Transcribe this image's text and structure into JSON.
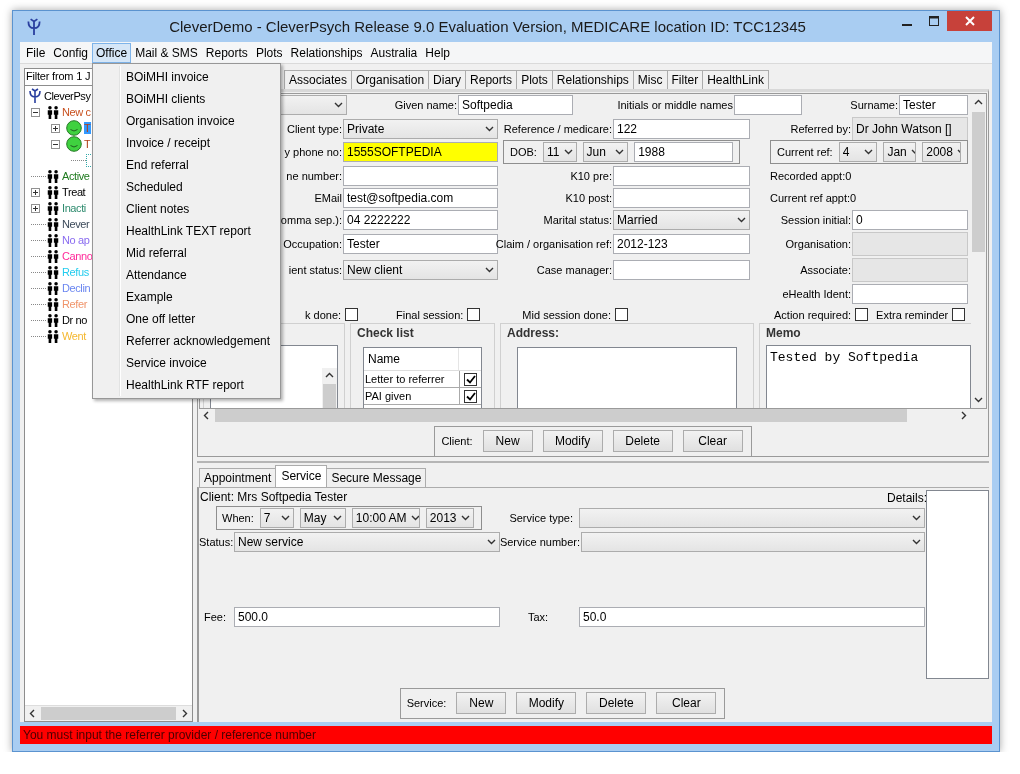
{
  "window": {
    "title": "CleverDemo - CleverPsych Release 9.0 Evaluation Version, MEDICARE location ID: TCC12345"
  },
  "menu_bar": [
    {
      "label": "File",
      "selected": false
    },
    {
      "label": "Config",
      "selected": false
    },
    {
      "label": "Office",
      "selected": true
    },
    {
      "label": "Mail & SMS",
      "selected": false
    },
    {
      "label": "Reports",
      "selected": false
    },
    {
      "label": "Plots",
      "selected": false
    },
    {
      "label": "Relationships",
      "selected": false
    },
    {
      "label": "Australia",
      "selected": false
    },
    {
      "label": "Help",
      "selected": false
    }
  ],
  "office_menu": [
    "BOiMHI invoice",
    "BOiMHI clients",
    "Organisation invoice",
    "Invoice / receipt",
    "End referral",
    "Scheduled",
    "Client notes",
    "HealthLink TEXT report",
    "Mid referral",
    "Attendance",
    "Example",
    "One off letter",
    "Referrer acknowledgement",
    "Service invoice",
    "HealthLink RTF report"
  ],
  "client_tree": {
    "filter": "Filter from 1 J",
    "items": [
      {
        "label": "CleverPsy",
        "kind": "root",
        "children": [
          {
            "label": "New c",
            "kind": "group",
            "color": "#c8501e",
            "expandable": true,
            "expanded": true,
            "children": [
              {
                "label": "T",
                "kind": "client",
                "selected": true,
                "expandable": true,
                "expanded": false
              },
              {
                "label": "T",
                "kind": "client",
                "selected": false,
                "expandable": true,
                "expanded": true,
                "children": [
                  {
                    "kind": "leaf",
                    "expandable": false
                  }
                ]
              }
            ]
          },
          {
            "label": "Active",
            "kind": "group",
            "color": "#1e7a1e",
            "expandable": false
          },
          {
            "label": "Treat",
            "kind": "group",
            "expandable": true,
            "expanded": false
          },
          {
            "label": "Inacti",
            "kind": "group",
            "color": "#2e8b6e",
            "expandable": true,
            "expanded": false
          },
          {
            "label": "Never",
            "kind": "group",
            "color": "#3c4a5a",
            "expandable": false
          },
          {
            "label": "No ap",
            "kind": "group",
            "color": "#8a6cf0",
            "expandable": false
          },
          {
            "label": "Canno",
            "kind": "group",
            "color": "#ff2a9a",
            "expandable": false
          },
          {
            "label": "Refus",
            "kind": "group",
            "color": "#22ccee",
            "expandable": false
          },
          {
            "label": "Declin",
            "kind": "group",
            "color": "#6a86f0",
            "expandable": false
          },
          {
            "label": "Refer",
            "kind": "group",
            "color": "#f0946a",
            "expandable": false
          },
          {
            "label": "Dr no",
            "kind": "group",
            "expandable": false
          },
          {
            "label": "Went",
            "kind": "group",
            "color": "#f5b830",
            "expandable": false
          }
        ]
      }
    ]
  },
  "client_tabs": [
    {
      "label": "Associates",
      "selected": false
    },
    {
      "label": "Organisation",
      "selected": false
    },
    {
      "label": "Diary",
      "selected": false
    },
    {
      "label": "Reports",
      "selected": false
    },
    {
      "label": "Plots",
      "selected": false
    },
    {
      "label": "Relationships",
      "selected": false
    },
    {
      "label": "Misc",
      "selected": false
    },
    {
      "label": "Filter",
      "selected": false
    },
    {
      "label": "HealthLink",
      "selected": false
    }
  ],
  "client_form": {
    "given_name": {
      "label": "Given name:",
      "value": "Softpedia"
    },
    "initials": {
      "label": "Initials or middle names"
    },
    "surname": {
      "label": "Surname:",
      "value": "Tester"
    },
    "rows": [
      [
        {
          "kind": "combo",
          "label": "Client type:",
          "value": "Private"
        },
        {
          "kind": "text",
          "label": "Reference / medicare:",
          "value": "122"
        },
        {
          "kind": "button",
          "label": "Referred by:",
          "value": "Dr John Watson []"
        }
      ],
      [
        {
          "kind": "text",
          "label": "y phone no:",
          "value": "1555SOFTPEDIA",
          "highlighted": true
        },
        {
          "kind": "date",
          "label": "DOB:",
          "parts": [
            {
              "kind": "combo",
              "value": "11"
            },
            {
              "kind": "combo",
              "value": "Jun"
            },
            {
              "kind": "text",
              "value": "1988"
            }
          ]
        },
        {
          "kind": "date",
          "label": "Current ref:",
          "parts": [
            {
              "kind": "combo",
              "value": "4"
            },
            {
              "kind": "combo",
              "value": "Jan"
            },
            {
              "kind": "combo",
              "value": "2008"
            }
          ]
        }
      ],
      [
        {
          "kind": "text",
          "label": "ne number:"
        },
        {
          "kind": "text",
          "label": "K10 pre:"
        },
        {
          "kind": "info",
          "label": "Recorded appt:0"
        }
      ],
      [
        {
          "kind": "text",
          "label": "EMail",
          "value": "test@softpedia.com"
        },
        {
          "kind": "text",
          "label": "K10 post:"
        },
        {
          "kind": "info",
          "label": "Current ref appt:0"
        }
      ],
      [
        {
          "kind": "text",
          "label": "omma sep.):",
          "value": "04 2222222"
        },
        {
          "kind": "combo",
          "label": "Marital status:",
          "value": "Married"
        },
        {
          "kind": "text",
          "label": "Session initial:",
          "value": "0"
        }
      ],
      [
        {
          "kind": "text",
          "label": "Occupation:",
          "value": "Tester"
        },
        {
          "kind": "text",
          "label": "Claim / organisation ref:",
          "value": "2012-123"
        },
        {
          "kind": "button",
          "label": "Organisation:"
        }
      ],
      [
        {
          "kind": "combo",
          "label": "ient status:",
          "value": "New client"
        },
        {
          "kind": "text",
          "label": "Case manager:"
        },
        {
          "kind": "button",
          "label": "Associate:"
        }
      ],
      [
        {
          "kind": "empty"
        },
        {
          "kind": "empty"
        },
        {
          "kind": "text",
          "label": "eHealth Ident:"
        }
      ]
    ],
    "checkboxes": [
      {
        "label": "k done:",
        "checked": false
      },
      {
        "label": "Final session:",
        "checked": false
      },
      {
        "label": "Mid session done:",
        "checked": false
      },
      {
        "label": "Action required:",
        "checked": false
      },
      {
        "label": "Extra reminder",
        "checked": false
      }
    ],
    "check_list": {
      "title": "Check list",
      "column": "Name",
      "rows": [
        {
          "label": "Letter to referrer",
          "checked": true
        },
        {
          "label": "PAI given",
          "checked": true
        }
      ]
    },
    "address": {
      "title": "Address:"
    },
    "memo": {
      "title": "Memo",
      "text": "Tested by Softpedia"
    }
  },
  "client_actions": {
    "label": "Client:",
    "buttons": [
      "New",
      "Modify",
      "Delete",
      "Clear"
    ]
  },
  "service_tabs": [
    {
      "label": "Appointment",
      "selected": false
    },
    {
      "label": "Service",
      "selected": true
    },
    {
      "label": "Secure Message",
      "selected": false
    }
  ],
  "service": {
    "client": "Client: Mrs Softpedia Tester",
    "details_label": "Details:",
    "when": {
      "label": "When:",
      "parts": [
        "7",
        "May",
        "10:00 AM",
        "2013"
      ]
    },
    "service_type": {
      "label": "Service type:"
    },
    "status": {
      "label": "Status:",
      "value": "New service"
    },
    "service_number": {
      "label": "Service number:"
    },
    "fee": {
      "label": "Fee:",
      "value": "500.0"
    },
    "tax": {
      "label": "Tax:",
      "value": "50.0"
    }
  },
  "service_actions": {
    "label": "Service:",
    "buttons": [
      "New",
      "Modify",
      "Delete",
      "Clear"
    ]
  },
  "status_bar": {
    "message": "You must input the referrer provider / reference number"
  }
}
